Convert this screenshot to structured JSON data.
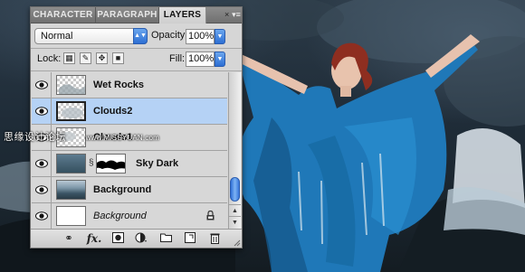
{
  "panel": {
    "tabs": [
      {
        "label": "CHARACTER",
        "active": false
      },
      {
        "label": "PARAGRAPH",
        "active": false
      },
      {
        "label": "LAYERS",
        "active": true
      }
    ],
    "tab_close_glyph": "×",
    "menu_glyph": "▾≡",
    "blend_mode": "Normal",
    "opacity_label": "Opacity:",
    "opacity_value": "100%",
    "lock_label": "Lock:",
    "fill_label": "Fill:",
    "fill_value": "100%",
    "selection_color": "#b5d2f5",
    "layers": [
      {
        "name": "Wet Rocks",
        "thumbnail": "transparent-checker",
        "visible": true,
        "selected": false,
        "style": "bold"
      },
      {
        "name": "Clouds2",
        "thumbnail": "transparent-checker",
        "visible": true,
        "selected": true,
        "style": "bold"
      },
      {
        "name": "Clouds1",
        "thumbnail": "transparent-checker",
        "visible": true,
        "selected": false,
        "style": "bold"
      },
      {
        "name": "Sky Dark",
        "thumbnail": "sky",
        "has_mask": true,
        "visible": true,
        "selected": false,
        "style": "bold"
      },
      {
        "name": "Background",
        "thumbnail": "sea",
        "visible": true,
        "selected": false,
        "style": "bold"
      },
      {
        "name": "Background",
        "thumbnail": "white",
        "visible": true,
        "selected": false,
        "style": "italic",
        "locked": true
      }
    ],
    "footer_icons": [
      "link-icon",
      "fx-icon",
      "add-mask-icon",
      "adjustment-layer-icon",
      "new-group-icon",
      "new-layer-icon",
      "trash-icon"
    ]
  },
  "watermark": {
    "text": "思缘设计论坛",
    "url": "www.MISSYUAN.com"
  }
}
